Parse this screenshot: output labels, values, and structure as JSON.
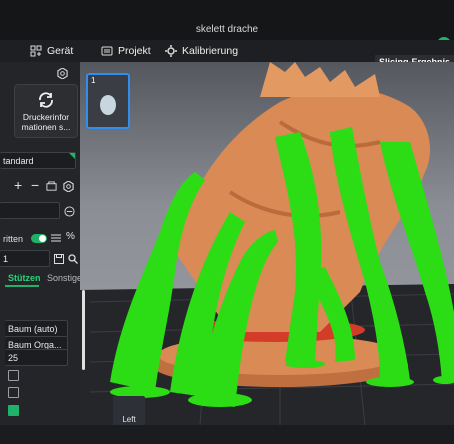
{
  "window": {
    "title": "skelett drache"
  },
  "topnav": {
    "tabs": [
      {
        "label": "Gerät"
      },
      {
        "label": "Projekt"
      },
      {
        "label": "Kalibrierung"
      }
    ],
    "slicing_result": "Slicing-Ergebnis"
  },
  "sidebar": {
    "printer_info": "Druckerinformationen s...",
    "printer_info_line1": "Druckerinfor",
    "printer_info_line2": "mationen s...",
    "preset_value": "tandard",
    "toggle_label": "ritten",
    "field_value": "1",
    "tabs": {
      "supports": "Stützen",
      "other": "Sonstige"
    },
    "options": [
      {
        "value": "Baum (auto)"
      },
      {
        "value": "Baum Orga..."
      },
      {
        "value": "25"
      }
    ]
  },
  "plate": {
    "number": "1"
  },
  "view": {
    "orientation": "Left"
  },
  "colors": {
    "accent": "#21b26a",
    "model": "#d98a55",
    "supports": "#2cdc14",
    "selection": "#2f8ff0"
  }
}
